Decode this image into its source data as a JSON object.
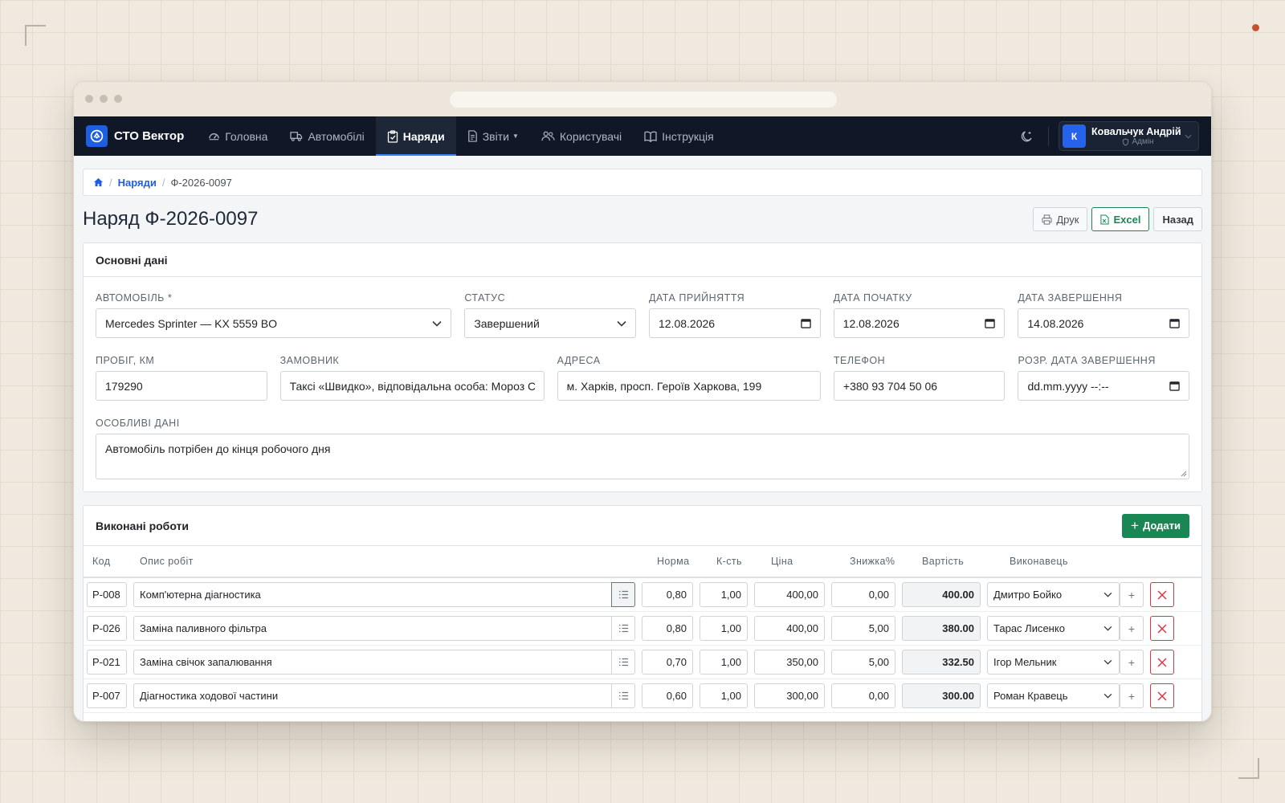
{
  "app": {
    "brand": "СТО Вектор"
  },
  "nav": {
    "items": [
      {
        "label": "Головна",
        "icon": "dashboard-icon"
      },
      {
        "label": "Автомобілі",
        "icon": "truck-icon"
      },
      {
        "label": "Наряди",
        "icon": "clipboard-icon",
        "active": true
      },
      {
        "label": "Звіти",
        "icon": "document-icon",
        "dropdown": true
      },
      {
        "label": "Користувачі",
        "icon": "users-icon"
      },
      {
        "label": "Інструкція",
        "icon": "book-icon"
      }
    ]
  },
  "user": {
    "initial": "К",
    "name": "Ковальчук Андрій",
    "role": "Адмін"
  },
  "breadcrumb": {
    "section": "Наряди",
    "current": "Ф-2026-0097"
  },
  "page": {
    "title": "Наряд Ф-2026-0097"
  },
  "actions": {
    "print": "Друк",
    "excel": "Excel",
    "back": "Назад"
  },
  "main_data": {
    "title": "Основні дані",
    "car": {
      "label": "Автомобіль *",
      "value": "Mercedes Sprinter — KX 5559 BO"
    },
    "status": {
      "label": "Статус",
      "value": "Завершений"
    },
    "date_accepted": {
      "label": "Дата прийняття",
      "value": "12.08.2026"
    },
    "date_start": {
      "label": "Дата початку",
      "value": "12.08.2026"
    },
    "date_end": {
      "label": "Дата завершення",
      "value": "14.08.2026"
    },
    "mileage": {
      "label": "Пробіг, км",
      "value": "179290"
    },
    "customer": {
      "label": "Замовник",
      "value": "Таксі «Швидко», відповідальна особа: Мороз Се"
    },
    "address": {
      "label": "Адреса",
      "value": "м. Харків, просп. Героїв Харкова, 199"
    },
    "phone": {
      "label": "Телефон",
      "value": "+380 93 704 50 06"
    },
    "est_date": {
      "label": "Розр. дата завершення",
      "value": "dd.mm.yyyy --:--"
    },
    "notes": {
      "label": "Особливі дані",
      "value": "Автомобіль потрібен до кінця робочого дня"
    }
  },
  "works": {
    "title": "Виконані роботи",
    "add_label": "Додати",
    "columns": {
      "code": "Код",
      "desc": "Опис робіт",
      "norm": "Норма",
      "qty": "К-сть",
      "price": "Ціна",
      "discount": "Знижка%",
      "cost": "Вартість",
      "executor": "Виконавець"
    },
    "rows": [
      {
        "code": "Р-008",
        "desc": "Комп'ютерна діагностика",
        "norm": "0,80",
        "qty": "1,00",
        "price": "400,00",
        "discount": "0,00",
        "cost": "400.00",
        "executor": "Дмитро Бойко"
      },
      {
        "code": "Р-026",
        "desc": "Заміна паливного фільтра",
        "norm": "0,80",
        "qty": "1,00",
        "price": "400,00",
        "discount": "5,00",
        "cost": "380.00",
        "executor": "Тарас Лисенко"
      },
      {
        "code": "Р-021",
        "desc": "Заміна свічок запалювання",
        "norm": "0,70",
        "qty": "1,00",
        "price": "350,00",
        "discount": "5,00",
        "cost": "332.50",
        "executor": "Ігор Мельник"
      },
      {
        "code": "Р-007",
        "desc": "Діагностика ходової частини",
        "norm": "0,60",
        "qty": "1,00",
        "price": "300,00",
        "discount": "0,00",
        "cost": "300.00",
        "executor": "Роман Кравець"
      }
    ]
  }
}
